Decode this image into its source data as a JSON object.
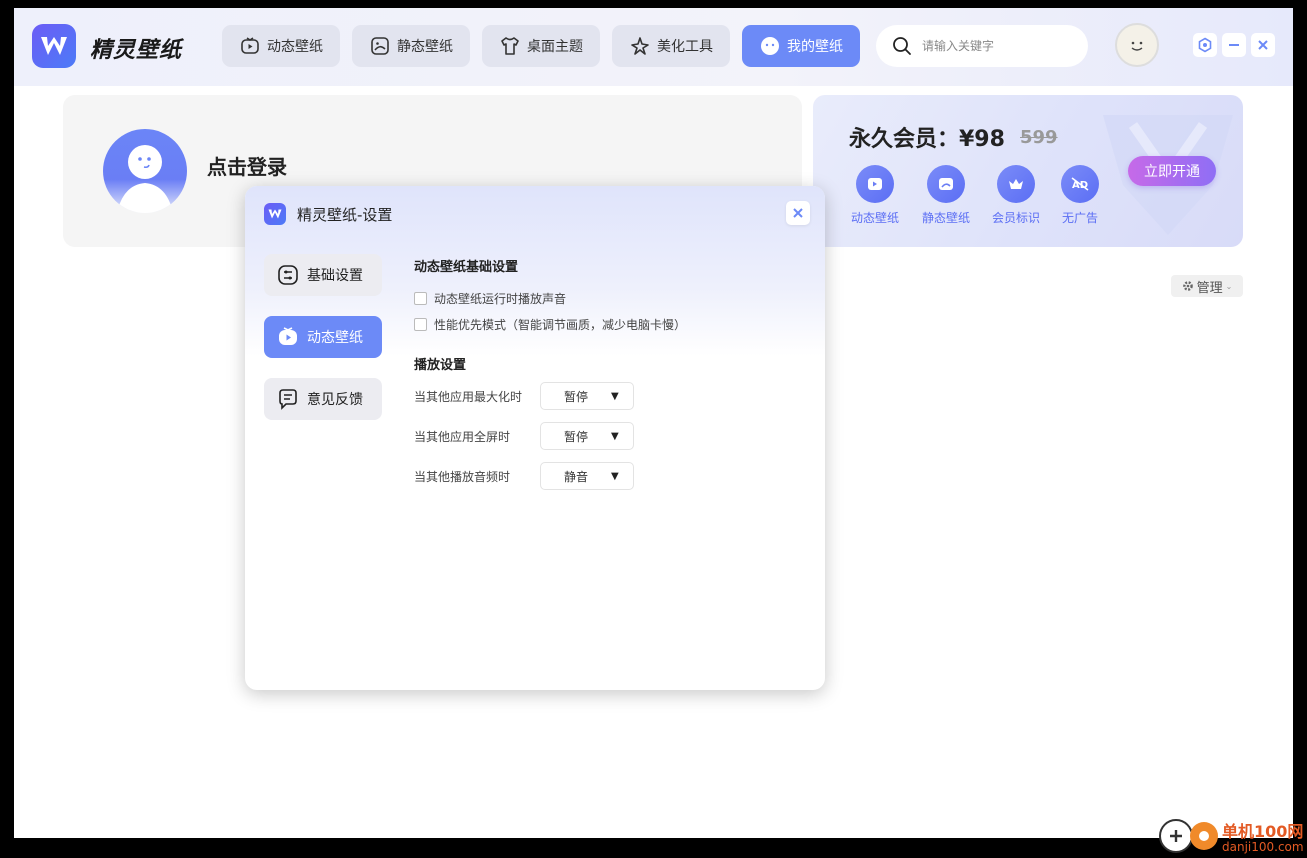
{
  "app": {
    "name": "精灵壁纸",
    "search_placeholder": "请输入关键字"
  },
  "nav": [
    {
      "label": "动态壁纸",
      "icon": "tv-icon"
    },
    {
      "label": "静态壁纸",
      "icon": "image-icon"
    },
    {
      "label": "桌面主题",
      "icon": "shirt-icon"
    },
    {
      "label": "美化工具",
      "icon": "sparkle-icon"
    },
    {
      "label": "我的壁纸",
      "icon": "smile-icon",
      "active": true
    }
  ],
  "login": {
    "label": "点击登录"
  },
  "vip": {
    "title": "永久会员：¥98",
    "old_price": "599",
    "open_label": "立即开通",
    "features": [
      {
        "label": "动态壁纸",
        "icon": "video-icon"
      },
      {
        "label": "静态壁纸",
        "icon": "picture-icon"
      },
      {
        "label": "会员标识",
        "icon": "crown-icon"
      },
      {
        "label": "无广告",
        "icon": "no-ad-icon"
      }
    ]
  },
  "manage": {
    "label": "管理"
  },
  "dialog": {
    "title": "精灵壁纸-设置",
    "tabs": [
      {
        "label": "基础设置",
        "icon": "sliders-icon"
      },
      {
        "label": "动态壁纸",
        "icon": "tv-icon",
        "active": true
      },
      {
        "label": "意见反馈",
        "icon": "chat-icon"
      }
    ],
    "section1_title": "动态壁纸基础设置",
    "checkboxes": [
      {
        "label": "动态壁纸运行时播放声音",
        "checked": false
      },
      {
        "label": "性能优先模式（智能调节画质，减少电脑卡慢）",
        "checked": false
      }
    ],
    "section2_title": "播放设置",
    "selects": [
      {
        "label": "当其他应用最大化时",
        "value": "暂停"
      },
      {
        "label": "当其他应用全屏时",
        "value": "暂停"
      },
      {
        "label": "当其他播放音频时",
        "value": "静音"
      }
    ]
  },
  "watermark": {
    "line1": "单机100网",
    "line2": "danji100.com"
  },
  "colors": {
    "accent": "#6c8af7",
    "vip_button": "#b06aee"
  }
}
